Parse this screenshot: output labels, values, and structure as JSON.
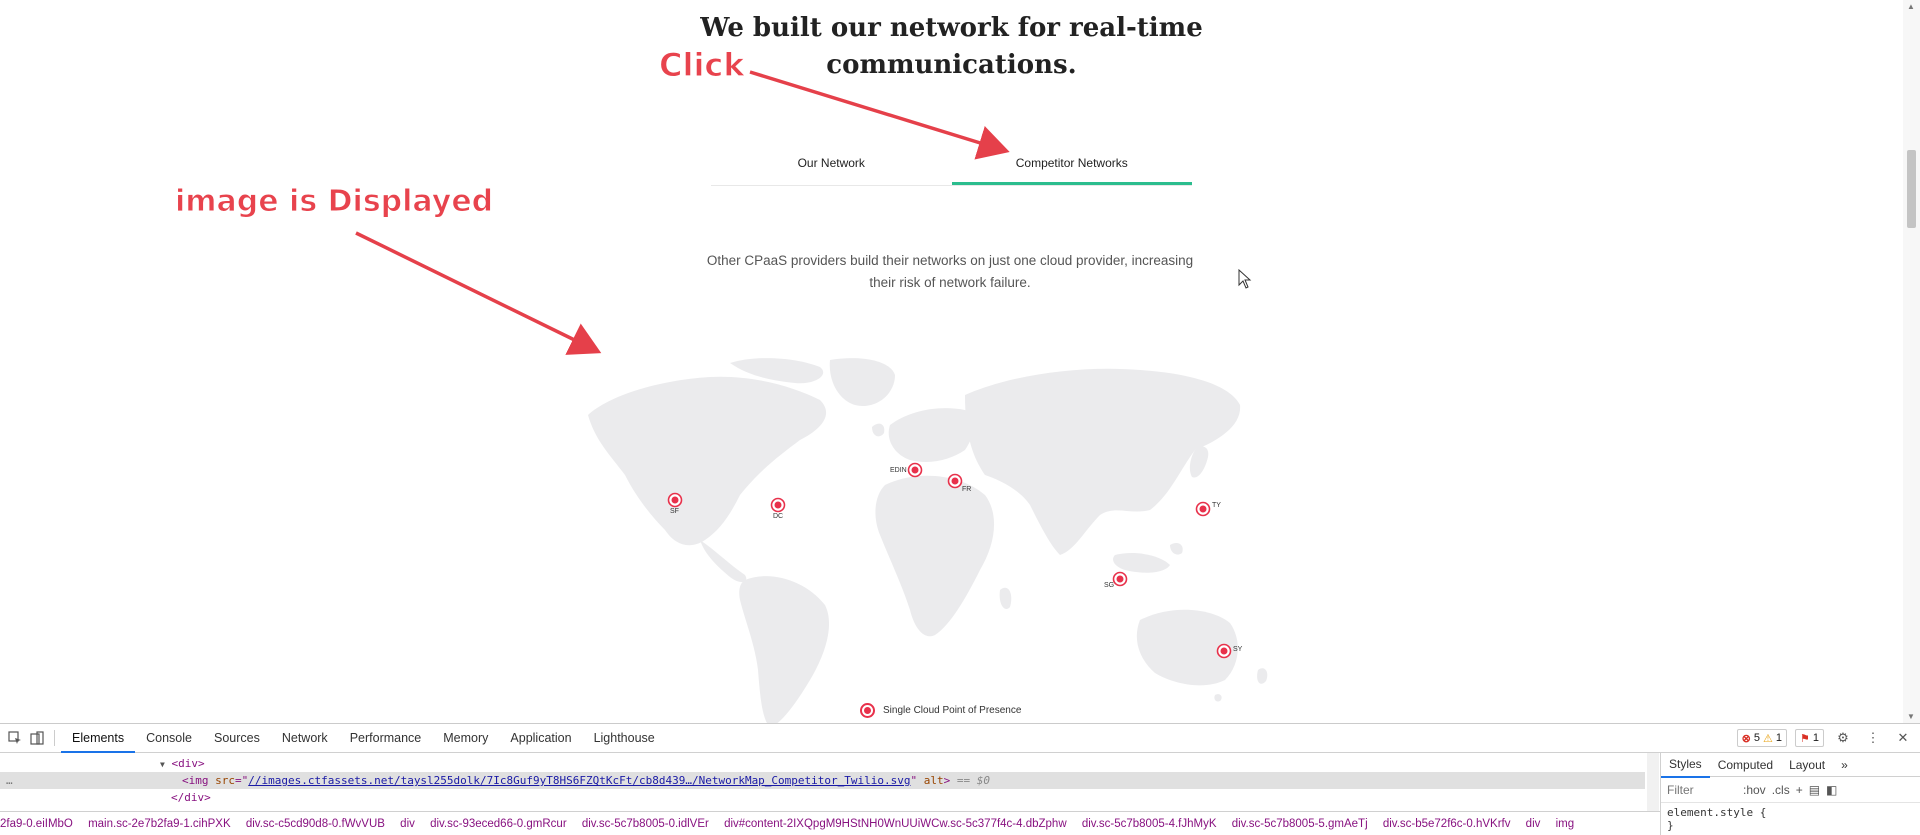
{
  "section": {
    "headline_line1": "We built our network for real-time",
    "headline_line2": "communications.",
    "tabs": [
      {
        "label": "Our Network"
      },
      {
        "label": "Competitor Networks"
      }
    ],
    "description_line1": "Other CPaaS providers build their networks on just one cloud provider, increasing",
    "description_line2": "their risk of network failure."
  },
  "map": {
    "points": [
      {
        "label": "SF"
      },
      {
        "label": "DC"
      },
      {
        "label": "EDIN"
      },
      {
        "label": "FR"
      },
      {
        "label": "TY"
      },
      {
        "label": "SG"
      },
      {
        "label": "SY"
      }
    ],
    "legend": "Single Cloud Point of Presence",
    "colors": {
      "land": "#ebebed",
      "marker": "#e8314b"
    }
  },
  "annotations": {
    "click": "Click",
    "image_displayed": "image is Displayed"
  },
  "devtools": {
    "tabs": [
      "Elements",
      "Console",
      "Sources",
      "Network",
      "Performance",
      "Memory",
      "Application",
      "Lighthouse"
    ],
    "active_tab": "Elements",
    "errors": "5",
    "warnings": "1",
    "issues": "1",
    "dom": {
      "line1": "<div>",
      "img_tag": "<img",
      "src_attr": "src",
      "src_value": "//images.ctfassets.net/taysl255dolk/7Ic8Guf9yT8HS6FZQtKcFt/cb8d439…/NetworkMap_Competitor_Twilio.svg",
      "alt_attr": "alt",
      "eq_sel": "== $0",
      "line3": "</div>"
    },
    "breadcrumbs": [
      "2fa9-0.eiIMbO",
      "main.sc-2e7b2fa9-1.cihPXK",
      "div.sc-c5cd90d8-0.fWvVUB",
      "div",
      "div.sc-93eced66-0.gmRcur",
      "div.sc-5c7b8005-0.idlVEr",
      "div#content-2IXQpgM9HStNH0WnUUiWCw.sc-5c377f4c-4.dbZphw",
      "div.sc-5c7b8005-4.fJhMyK",
      "div.sc-5c7b8005-5.gmAeTj",
      "div.sc-b5e72f6c-0.hVKrfv",
      "div",
      "img"
    ],
    "styles_tabs": [
      "Styles",
      "Computed",
      "Layout"
    ],
    "filter_placeholder": "Filter",
    "hov": ":hov",
    "cls": ".cls",
    "element_style": "element.style {",
    "close_brace": "}"
  }
}
